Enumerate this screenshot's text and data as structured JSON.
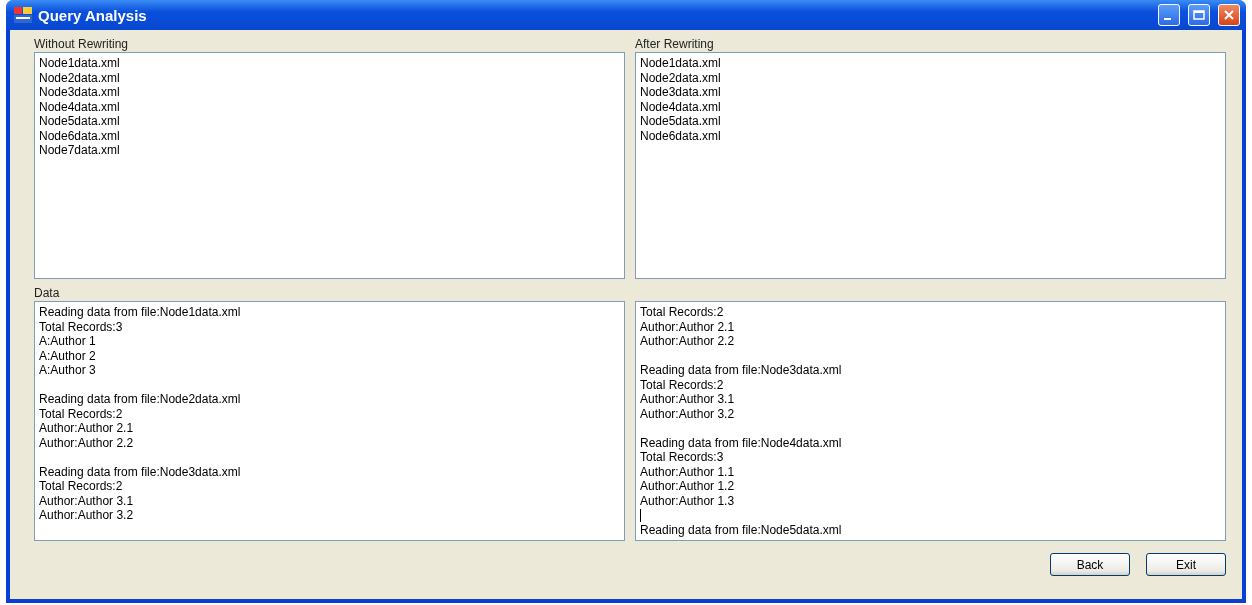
{
  "window": {
    "title": "Query Analysis"
  },
  "without_rewriting": {
    "label": "Without Rewriting",
    "items": [
      "Node1data.xml",
      "Node2data.xml",
      "Node3data.xml",
      "Node4data.xml",
      "Node5data.xml",
      "Node6data.xml",
      "Node7data.xml"
    ]
  },
  "after_rewriting": {
    "label": "After Rewriting",
    "items": [
      "Node1data.xml",
      "Node2data.xml",
      "Node3data.xml",
      "Node4data.xml",
      "Node5data.xml",
      "Node6data.xml"
    ]
  },
  "data": {
    "label": "Data",
    "left": [
      {
        "lines": [
          "Reading data from file:Node1data.xml",
          "Total Records:3",
          "A:Author 1",
          "A:Author 2",
          "A:Author 3"
        ],
        "caret": false
      },
      {
        "lines": [
          "Reading data from file:Node2data.xml",
          "Total Records:2",
          "Author:Author 2.1",
          "Author:Author 2.2"
        ],
        "caret": false
      },
      {
        "lines": [
          "Reading data from file:Node3data.xml",
          "Total Records:2",
          "Author:Author 3.1",
          "Author:Author 3.2"
        ],
        "caret": false
      }
    ],
    "right": [
      {
        "lines": [
          "Total Records:2",
          "Author:Author 2.1",
          "Author:Author 2.2"
        ],
        "caret": false
      },
      {
        "lines": [
          "Reading data from file:Node3data.xml",
          "Total Records:2",
          "Author:Author 3.1",
          "Author:Author 3.2"
        ],
        "caret": false
      },
      {
        "lines": [
          "Reading data from file:Node4data.xml",
          "Total Records:3",
          "Author:Author 1.1",
          "Author:Author 1.2",
          "Author:Author 1.3"
        ],
        "caret": true
      },
      {
        "lines": [
          "Reading data from file:Node5data.xml"
        ],
        "caret": false
      }
    ]
  },
  "buttons": [
    "Back",
    "Exit"
  ]
}
